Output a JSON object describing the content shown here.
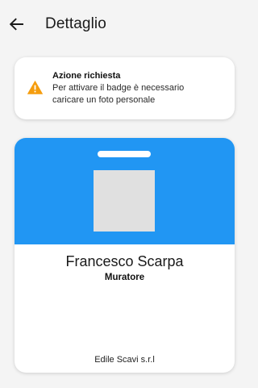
{
  "header": {
    "title": "Dettaglio",
    "back_icon": "arrow-left-icon"
  },
  "alert": {
    "icon": "warning-triangle-icon",
    "icon_color": "#f59d0e",
    "title": "Azione richiesta",
    "message": "Per attivare il badge è necessario caricare un foto personale"
  },
  "badge": {
    "header_color": "#2196f3",
    "photo_placeholder_color": "#e0e0e0",
    "name": "Francesco Scarpa",
    "role": "Muratore",
    "company": "Edile Scavi s.r.l"
  }
}
